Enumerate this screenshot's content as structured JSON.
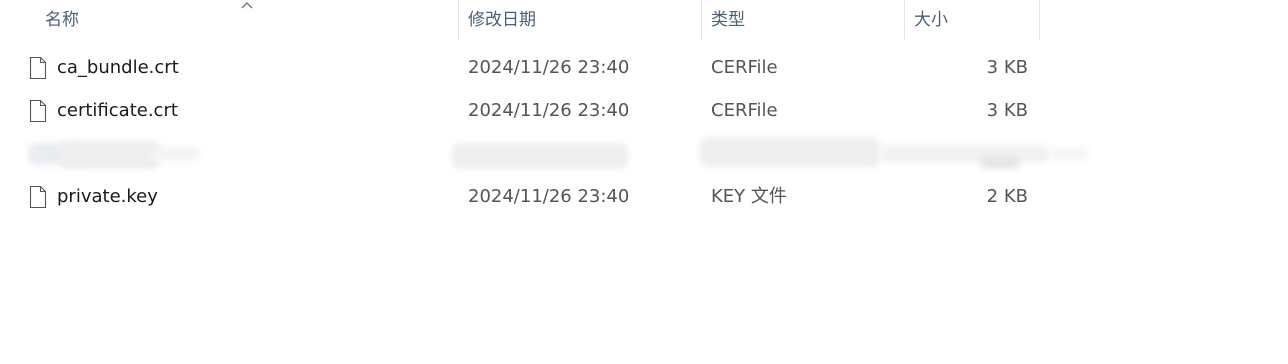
{
  "columns": {
    "name": "名称",
    "date": "修改日期",
    "type": "类型",
    "size": "大小"
  },
  "icons": {
    "sort": "chevron-up-icon",
    "file": "file-icon"
  },
  "files": [
    {
      "name": "ca_bundle.crt",
      "date": "2024/11/26 23:40",
      "type": "CERFile",
      "size": "3 KB"
    },
    {
      "name": "certificate.crt",
      "date": "2024/11/26 23:40",
      "type": "CERFile",
      "size": "3 KB"
    },
    {
      "name": "private.key",
      "date": "2024/11/26 23:40",
      "type": "KEY 文件",
      "size": "2 KB"
    }
  ],
  "colors": {
    "header_text": "#4c607a",
    "name_text": "#1a1a1a",
    "meta_text": "#555555",
    "divider": "#e5e5e5"
  }
}
